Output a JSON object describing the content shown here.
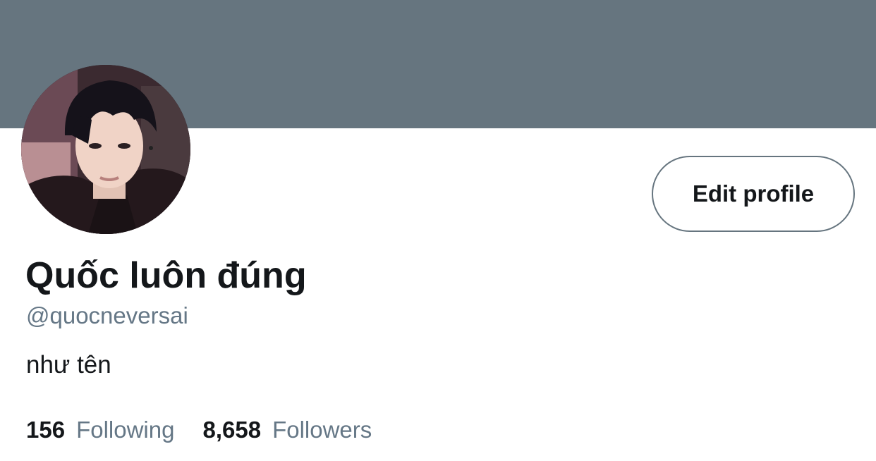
{
  "profile": {
    "display_name": "Quốc luôn đúng",
    "handle": "@quocneversai",
    "bio": "như tên",
    "edit_button_label": "Edit profile"
  },
  "stats": {
    "following_count": "156",
    "following_label": "Following",
    "followers_count": "8,658",
    "followers_label": "Followers"
  },
  "colors": {
    "banner": "#66757f",
    "text_primary": "#14171a",
    "text_secondary": "#657786",
    "button_border": "#66757f"
  },
  "icons": {
    "avatar": "profile-photo"
  }
}
